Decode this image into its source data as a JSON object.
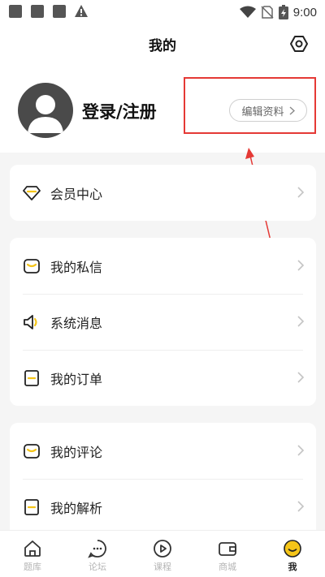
{
  "status_bar": {
    "time": "9:00"
  },
  "header": {
    "title": "我的"
  },
  "profile": {
    "login_label": "登录/注册",
    "edit_profile_label": "编辑资料"
  },
  "menu": {
    "vip": [
      {
        "label": "会员中心",
        "icon": "diamond-icon"
      }
    ],
    "messages": [
      {
        "label": "我的私信",
        "icon": "message-icon"
      },
      {
        "label": "系统消息",
        "icon": "speaker-icon"
      },
      {
        "label": "我的订单",
        "icon": "document-icon"
      }
    ],
    "content": [
      {
        "label": "我的评论",
        "icon": "comment-icon"
      },
      {
        "label": "我的解析",
        "icon": "document-icon"
      }
    ]
  },
  "tabbar": {
    "items": [
      {
        "label": "题库",
        "icon": "home-icon"
      },
      {
        "label": "论坛",
        "icon": "chat-icon"
      },
      {
        "label": "课程",
        "icon": "play-icon"
      },
      {
        "label": "商城",
        "icon": "wallet-icon"
      },
      {
        "label": "我",
        "icon": "smiley-icon"
      }
    ],
    "active_index": 4
  },
  "colors": {
    "accent": "#f5c518",
    "annotation": "#e53935"
  }
}
